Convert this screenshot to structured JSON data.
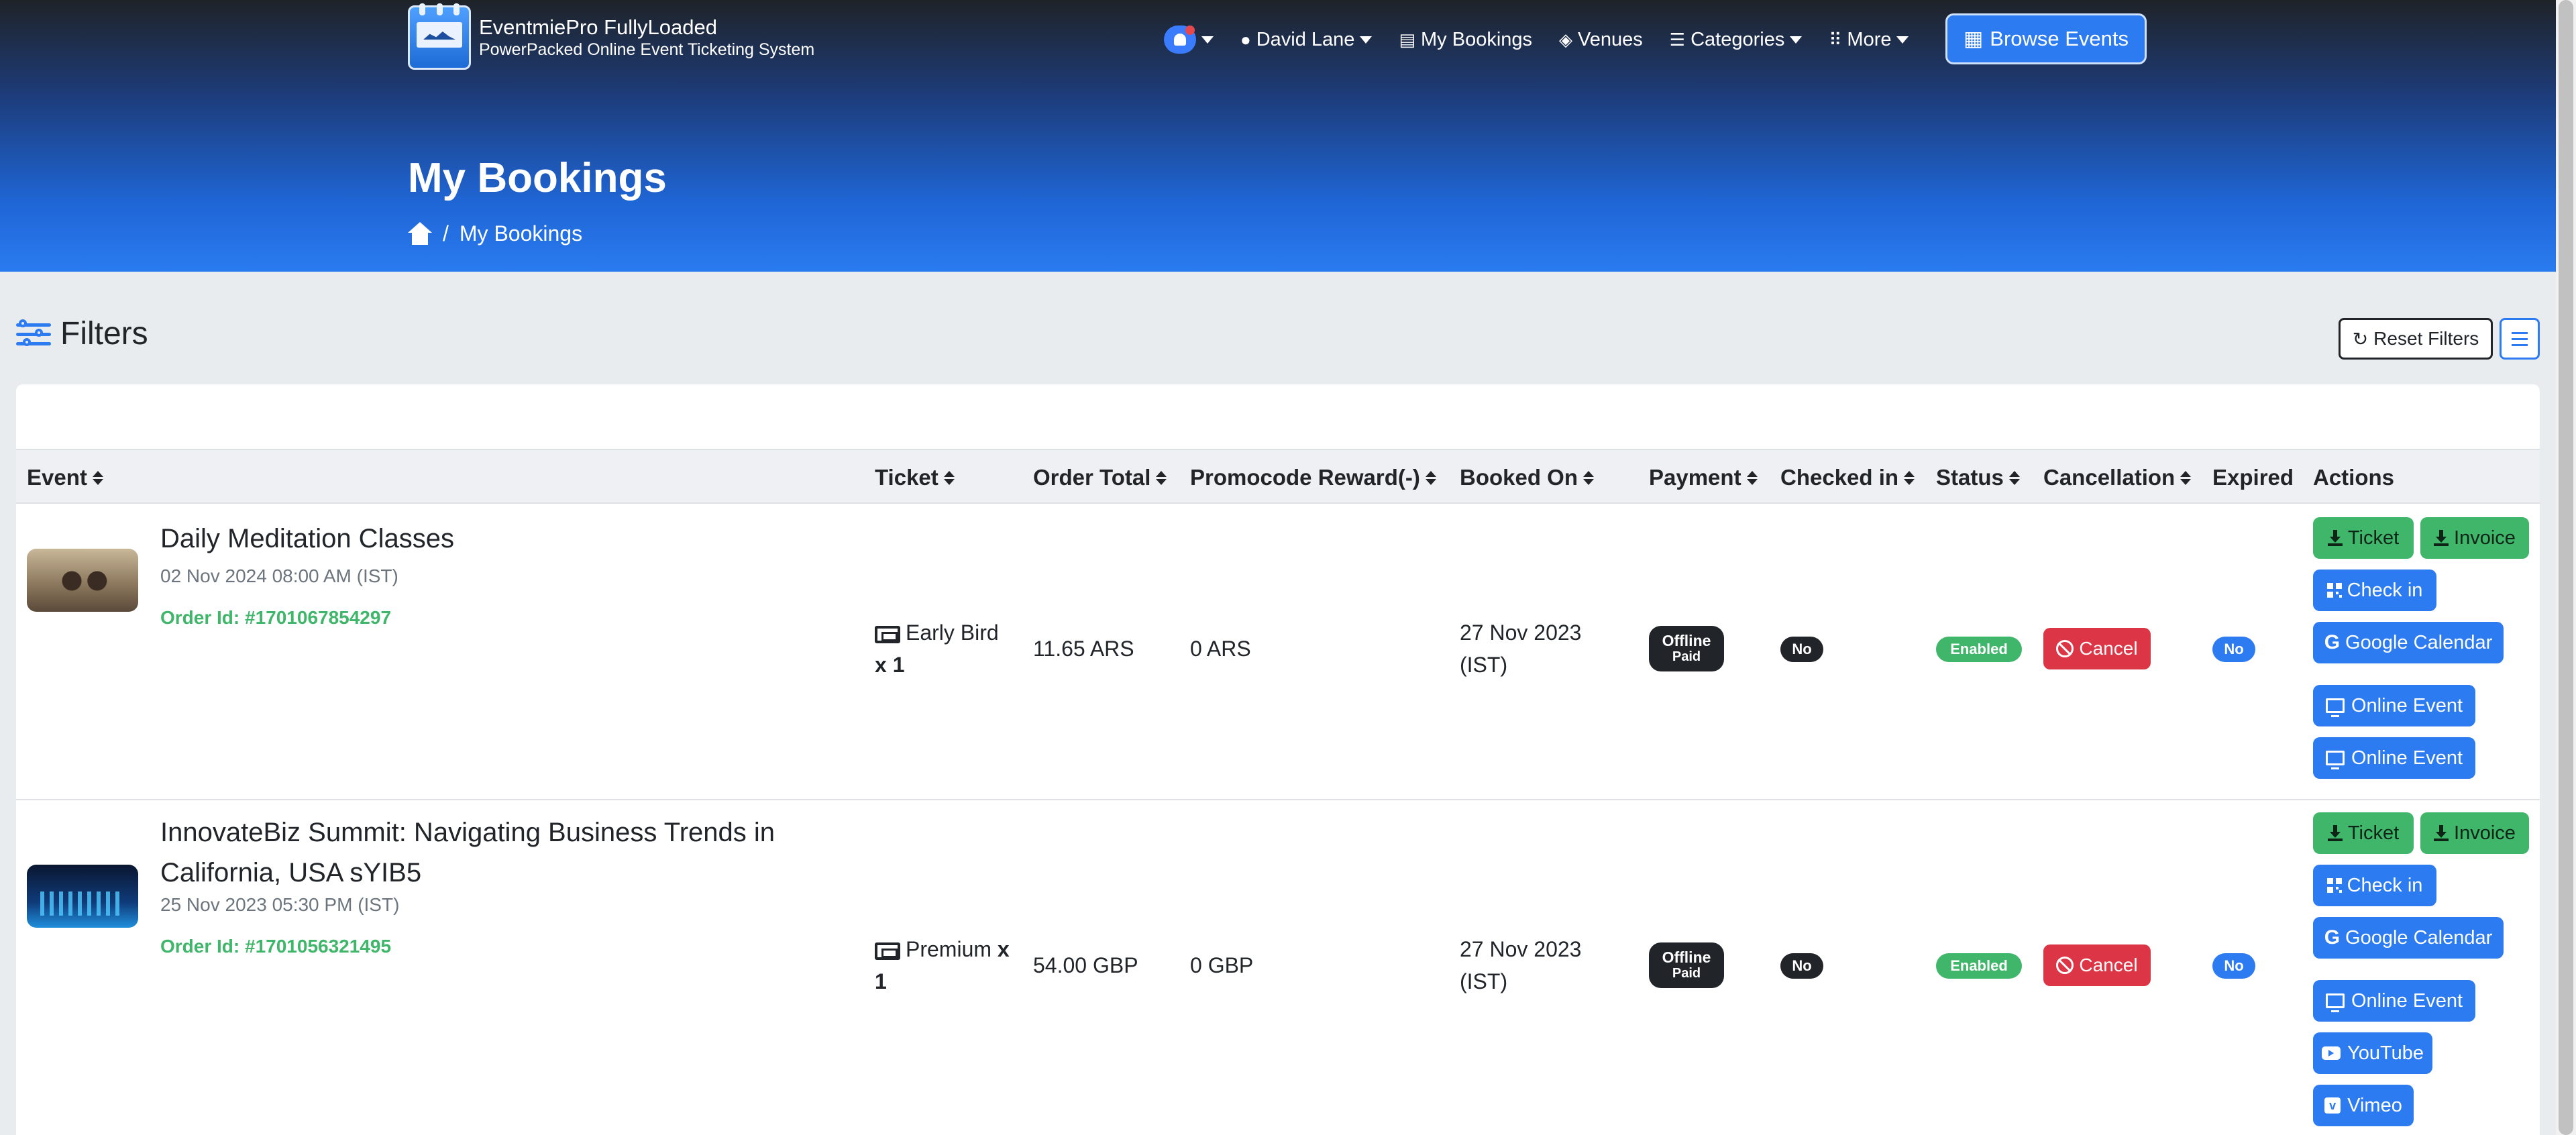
{
  "app": {
    "title": "EventmiePro FullyLoaded",
    "subtitle": "PowerPacked Online Event Ticketing System"
  },
  "nav": {
    "user_label": "David Lane",
    "my_bookings_label": "My Bookings",
    "venues_label": "Venues",
    "categories_label": "Categories",
    "more_label": "More",
    "browse_label": "Browse Events"
  },
  "page": {
    "title": "My Bookings",
    "breadcrumb_current": "My Bookings",
    "breadcrumb_separator": "/"
  },
  "filters": {
    "label": "Filters",
    "reset_label": "Reset Filters"
  },
  "table": {
    "headers": [
      "Event",
      "Ticket",
      "Order Total",
      "Promocode Reward(-)",
      "Booked On",
      "Payment",
      "Checked in",
      "Status",
      "Cancellation",
      "Expired",
      "Actions"
    ],
    "rows": [
      {
        "title_line1": "Daily Meditation Classes",
        "title_line2": "",
        "date": "02 Nov 2024 08:00 AM (IST)",
        "order_id": "Order Id: #1701067854297",
        "ticket_name": "Early Bird",
        "ticket_qty": "x 1",
        "order_total": "11.65 ARS",
        "promocode": "0 ARS",
        "booked_on_line1": "27 Nov 2023",
        "booked_on_line2": "(IST)",
        "payment_top": "Offline",
        "payment_bottom": "Paid",
        "checked_in": "No",
        "status": "Enabled",
        "cancel_label": "Cancel",
        "expired": "No",
        "actions": {
          "ticket": "Ticket",
          "invoice": "Invoice",
          "checkin": "Check in",
          "google": "Google Calendar",
          "online1": "Online Event",
          "online2": "Online Event"
        }
      },
      {
        "title_line1": "InnovateBiz Summit: Navigating Business Trends in",
        "title_line2": "California, USA sYIB5",
        "date": "25 Nov 2023 05:30 PM (IST)",
        "order_id": "Order Id: #1701056321495",
        "ticket_name": "Premium",
        "ticket_qty_inline": "x",
        "ticket_qty": "1",
        "order_total": "54.00 GBP",
        "promocode": "0 GBP",
        "booked_on_line1": "27 Nov 2023",
        "booked_on_line2": "(IST)",
        "payment_top": "Offline",
        "payment_bottom": "Paid",
        "checked_in": "No",
        "status": "Enabled",
        "cancel_label": "Cancel",
        "expired": "No",
        "actions": {
          "ticket": "Ticket",
          "invoice": "Invoice",
          "checkin": "Check in",
          "google": "Google Calendar",
          "online1": "Online Event",
          "youtube": "YouTube",
          "vimeo": "Vimeo"
        }
      }
    ]
  },
  "colors": {
    "primary": "#2d7bf0",
    "success": "#3fb66a",
    "danger": "#dc3545",
    "dark": "#212529"
  }
}
